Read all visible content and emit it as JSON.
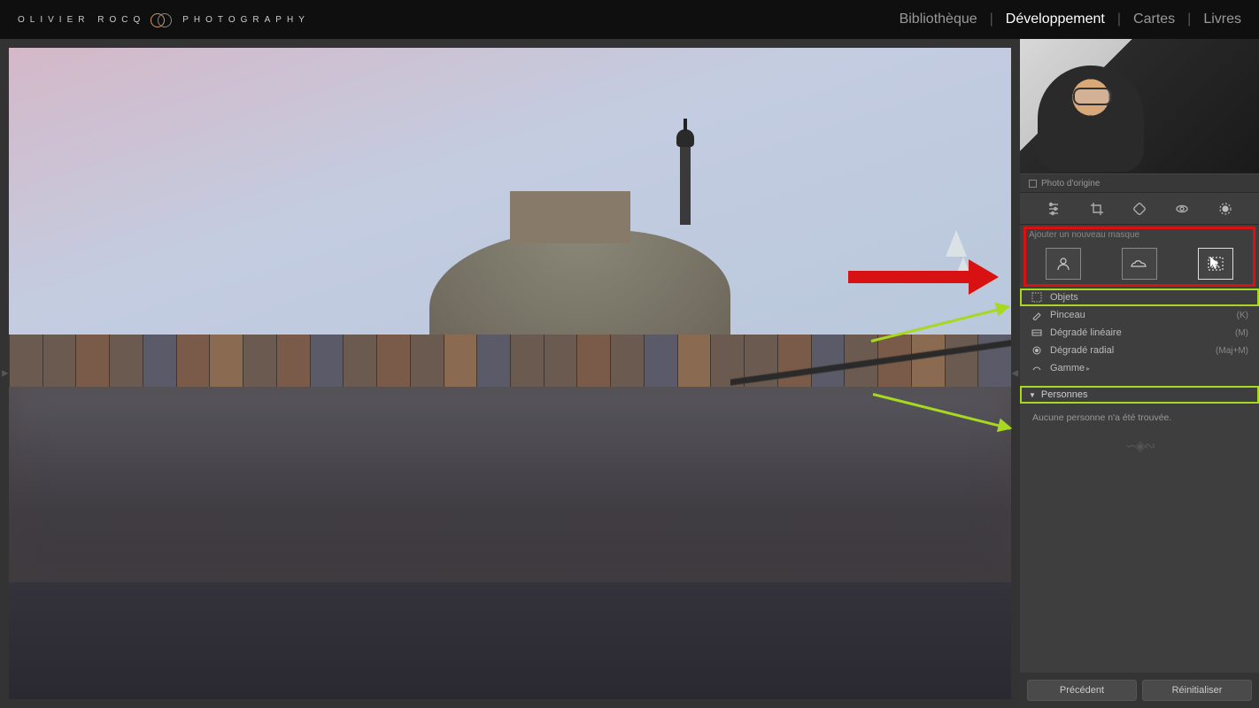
{
  "brand": {
    "left": "OLIVIER ROCQ",
    "right": "PHOTOGRAPHY"
  },
  "modules": {
    "library": "Bibliothèque",
    "develop": "Développement",
    "map": "Cartes",
    "book": "Livres"
  },
  "panel": {
    "origin_label": "Photo d'origine",
    "mask_header": "Ajouter un nouveau masque",
    "mask_icons": {
      "subject": "subject-icon",
      "sky": "sky-icon",
      "background": "background-icon"
    },
    "tools": {
      "objects": {
        "label": "Objets",
        "shortcut": ""
      },
      "brush": {
        "label": "Pinceau",
        "shortcut": "(K)"
      },
      "linear": {
        "label": "Dégradé linéaire",
        "shortcut": "(M)"
      },
      "radial": {
        "label": "Dégradé radial",
        "shortcut": "(Maj+M)"
      },
      "range": {
        "label": "Gamme",
        "shortcut": ""
      }
    },
    "people_header": "Personnes",
    "people_msg": "Aucune personne n'a été trouvée.",
    "buttons": {
      "prev": "Précédent",
      "reset": "Réinitialiser"
    }
  }
}
